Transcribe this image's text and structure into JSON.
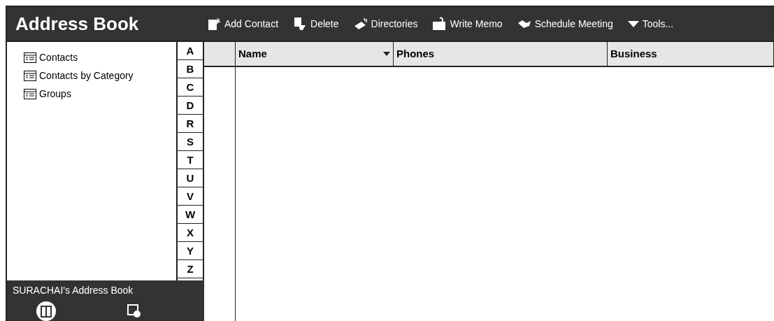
{
  "window": {
    "title": "Address Book"
  },
  "toolbar": [
    {
      "label": "Add Contact",
      "kind": "add"
    },
    {
      "label": "Delete",
      "kind": "delete"
    },
    {
      "label": "Directories",
      "kind": "directories"
    },
    {
      "label": "Write Memo",
      "kind": "memo"
    },
    {
      "label": "Schedule Meeting",
      "kind": "meeting"
    },
    {
      "label": "Tools...",
      "kind": "menu"
    }
  ],
  "sidebar": {
    "items": [
      "Contacts",
      "Contacts by Category",
      "Groups"
    ],
    "footer": {
      "title": "SURACHAI's Address Book"
    }
  },
  "alphabet": [
    "A",
    "B",
    "C",
    "D",
    "R",
    "S",
    "T",
    "U",
    "V",
    "W",
    "X",
    "Y",
    "Z"
  ],
  "table": {
    "columns": [
      {
        "label": "Name",
        "sortable": true
      },
      {
        "label": "Phones",
        "sortable": false
      },
      {
        "label": "Business",
        "sortable": false
      }
    ]
  }
}
